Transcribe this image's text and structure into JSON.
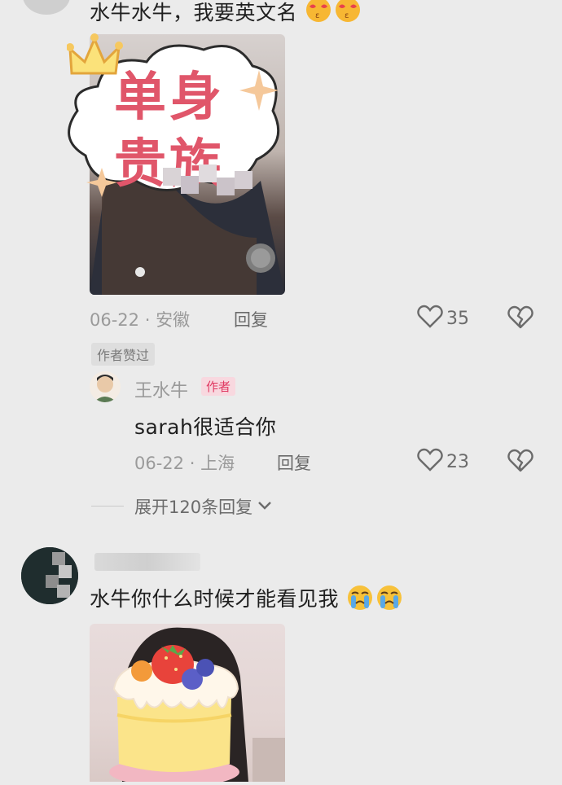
{
  "comment1": {
    "text": "水牛水牛，我要英文名",
    "image_stamp_text": [
      "单身",
      "贵族"
    ],
    "date": "06-22",
    "location": "安徽",
    "reply_label": "回复",
    "like_count": "35",
    "author_liked_badge": "作者赞过"
  },
  "author_reply": {
    "username": "王水牛",
    "author_tag": "作者",
    "text": "sarah很适合你",
    "date": "06-22",
    "location": "上海",
    "reply_label": "回复",
    "like_count": "23"
  },
  "expand_replies": {
    "label": "展开120条回复"
  },
  "comment2": {
    "text": "水牛你什么时候才能看见我"
  },
  "meta_separator": "·"
}
